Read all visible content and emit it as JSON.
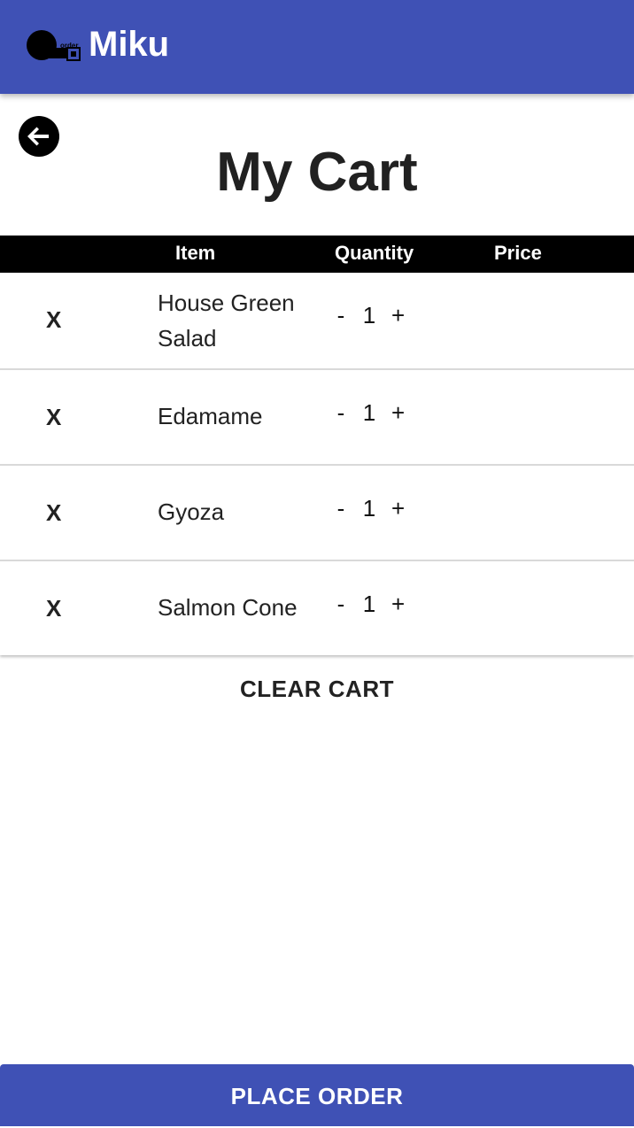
{
  "app_bar": {
    "brand": "Miku",
    "logo_text": "order",
    "logo_icon": "qr-order-logo-icon",
    "color": "#3f51b5"
  },
  "back": {
    "icon": "arrow-left-icon"
  },
  "page": {
    "title": "My Cart"
  },
  "table": {
    "headers": {
      "item": "Item",
      "quantity": "Quantity",
      "price": "Price"
    },
    "rows": [
      {
        "remove_label": "X",
        "item": "House Green Salad",
        "quantity": "1",
        "minus": "-",
        "plus": "+",
        "price": ""
      },
      {
        "remove_label": "X",
        "item": "Edamame",
        "quantity": "1",
        "minus": "-",
        "plus": "+",
        "price": ""
      },
      {
        "remove_label": "X",
        "item": "Gyoza",
        "quantity": "1",
        "minus": "-",
        "plus": "+",
        "price": ""
      },
      {
        "remove_label": "X",
        "item": "Salmon Cone",
        "quantity": "1",
        "minus": "-",
        "plus": "+",
        "price": ""
      }
    ]
  },
  "actions": {
    "clear_cart": "CLEAR CART",
    "place_order": "PLACE ORDER"
  }
}
